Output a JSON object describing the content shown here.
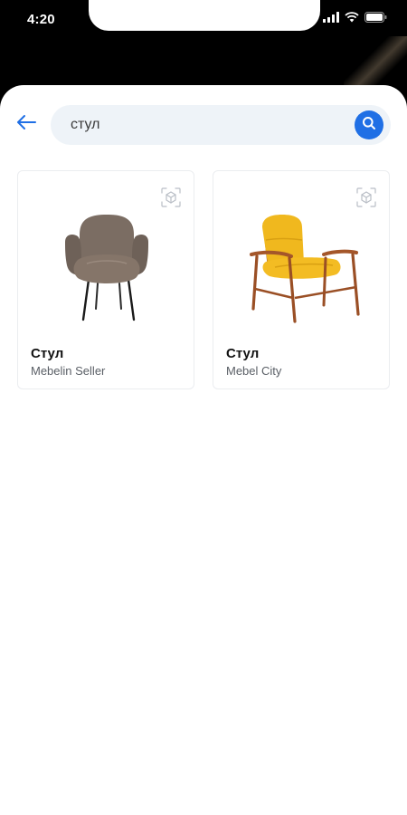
{
  "status_bar": {
    "time": "4:20"
  },
  "search": {
    "value": "стул",
    "placeholder": ""
  },
  "icons": {
    "back": "arrow-left-icon",
    "search": "search-icon",
    "ar": "ar-cube-icon"
  },
  "colors": {
    "accent": "#1f6fe5",
    "search_bg": "#eef3f8"
  },
  "products": [
    {
      "title": "Стул",
      "seller": "Mebelin Seller"
    },
    {
      "title": "Стул",
      "seller": "Mebel City"
    }
  ]
}
